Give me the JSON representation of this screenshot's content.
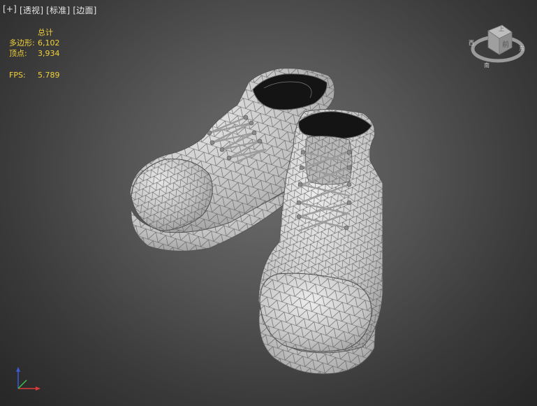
{
  "viewport": {
    "labels": [
      "[+]",
      "[透视]",
      "[标准]",
      "[边面]"
    ]
  },
  "stats": {
    "header": "总计",
    "polygons_label": "多边形:",
    "polygons_value": "6,102",
    "vertices_label": "顶点:",
    "vertices_value": "3,934",
    "fps_label": "FPS:",
    "fps_value": "5.789"
  },
  "viewcube": {
    "face": "前",
    "top_label": "上",
    "compass": {
      "west": "西",
      "east": "东",
      "south": "南"
    }
  },
  "colors": {
    "stats_text": "#f2d23a",
    "label_text": "#e6e6e6",
    "mesh_fill": "#c4c4c4",
    "wire": "#5a5a5a"
  }
}
